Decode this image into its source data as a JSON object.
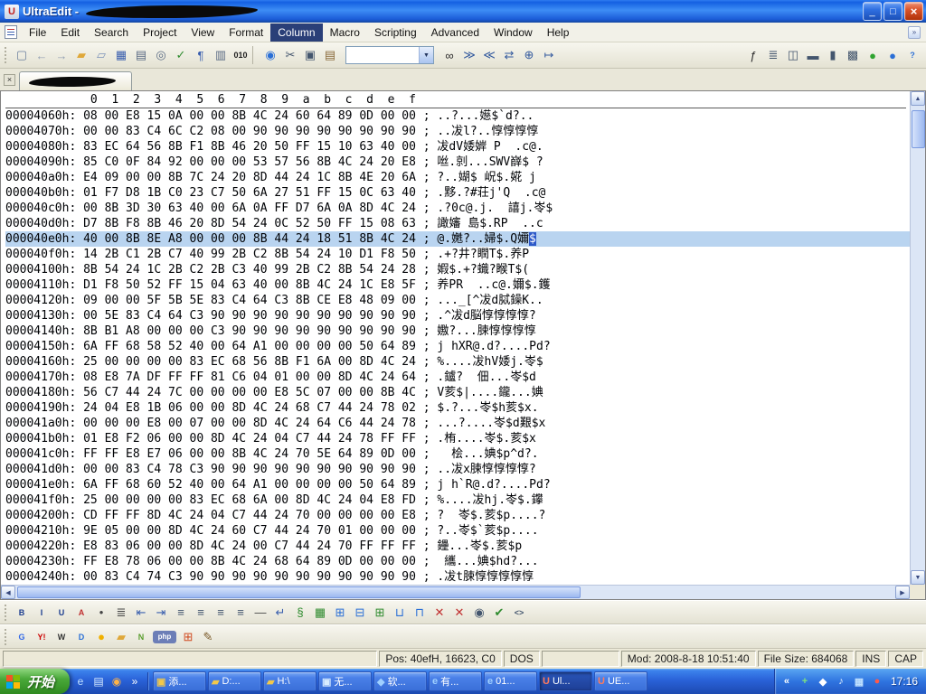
{
  "window": {
    "title": "UltraEdit -",
    "minimize_glyph": "_",
    "maximize_glyph": "□",
    "close_glyph": "×"
  },
  "menu": {
    "items": [
      {
        "name": "menu-item-file",
        "label": "File"
      },
      {
        "name": "menu-item-edit",
        "label": "Edit"
      },
      {
        "name": "menu-item-search",
        "label": "Search"
      },
      {
        "name": "menu-item-project",
        "label": "Project"
      },
      {
        "name": "menu-item-view",
        "label": "View"
      },
      {
        "name": "menu-item-format",
        "label": "Format"
      },
      {
        "name": "menu-item-column",
        "label": "Column",
        "cls": "active"
      },
      {
        "name": "menu-item-macro",
        "label": "Macro"
      },
      {
        "name": "menu-item-scripting",
        "label": "Scripting"
      },
      {
        "name": "menu-item-advanced",
        "label": "Advanced"
      },
      {
        "name": "menu-item-window",
        "label": "Window"
      },
      {
        "name": "menu-item-help",
        "label": "Help"
      }
    ]
  },
  "toolbar": {
    "search_value": "",
    "combo_arrow": "▼",
    "group_a": [
      {
        "name": "new-file-icon",
        "g": "▢",
        "c": "#6b7f9e"
      },
      {
        "name": "back-icon",
        "g": "←",
        "c": "#93a0b4"
      },
      {
        "name": "forward-icon",
        "g": "→",
        "c": "#93a0b4"
      },
      {
        "name": "open-file-icon",
        "g": "▰",
        "c": "#dfa83a"
      },
      {
        "name": "ftp-open-icon",
        "g": "▱",
        "c": "#7a92b8"
      },
      {
        "name": "save-icon",
        "g": "▦",
        "c": "#3a5fae"
      },
      {
        "name": "print-icon",
        "g": "▤",
        "c": "#5a6b84"
      },
      {
        "name": "print-preview-icon",
        "g": "◎",
        "c": "#5a6b84"
      },
      {
        "name": "spell-check-icon",
        "g": "✓",
        "c": "#2e8b2e"
      },
      {
        "name": "word-wrap-icon",
        "g": "¶",
        "c": "#3a5fae"
      },
      {
        "name": "column-mode-icon",
        "g": "▥",
        "c": "#5a6b84"
      },
      {
        "name": "hex-edit-icon",
        "g": "010",
        "c": "#1c1c1c",
        "cls": "txt"
      },
      {
        "name": "separator",
        "g": "",
        "cls": "sep"
      }
    ],
    "group_b": [
      {
        "name": "browser-view-icon",
        "g": "◉",
        "c": "#2a6fd6"
      },
      {
        "name": "cut-icon",
        "g": "✂",
        "c": "#44566e"
      },
      {
        "name": "copy-icon",
        "g": "▣",
        "c": "#44566e"
      },
      {
        "name": "paste-icon",
        "g": "▤",
        "c": "#8a6b3c"
      }
    ],
    "group_c": [
      {
        "name": "find-icon",
        "g": "∞",
        "c": "#2c2c2c"
      },
      {
        "name": "find-next-icon",
        "g": "≫",
        "c": "#335a9e"
      },
      {
        "name": "find-prev-icon",
        "g": "≪",
        "c": "#335a9e"
      },
      {
        "name": "replace-icon",
        "g": "⇄",
        "c": "#335a9e"
      },
      {
        "name": "find-in-files-icon",
        "g": "⊕",
        "c": "#335a9e"
      },
      {
        "name": "goto-icon",
        "g": "↦",
        "c": "#335a9e"
      }
    ],
    "group_d": [
      {
        "name": "function-list-icon",
        "g": "ƒ",
        "c": "#2c2c2c"
      },
      {
        "name": "tag-list-icon",
        "g": "≣",
        "c": "#44566e"
      },
      {
        "name": "split-window-icon",
        "g": "◫",
        "c": "#44566e"
      },
      {
        "name": "tile-horizontal-icon",
        "g": "▬",
        "c": "#44566e"
      },
      {
        "name": "tile-vertical-icon",
        "g": "▮",
        "c": "#44566e"
      },
      {
        "name": "cascade-icon",
        "g": "▩",
        "c": "#44566e"
      },
      {
        "name": "macro-play-icon",
        "g": "●",
        "c": "#2fa32f"
      },
      {
        "name": "macro-record-icon",
        "g": "●",
        "c": "#2a6fd6"
      },
      {
        "name": "help-icon",
        "g": "?",
        "c": "#2a6fd6",
        "cls": "txt"
      }
    ]
  },
  "tabbar": {
    "close_glyph": "×"
  },
  "hex": {
    "header": "            0  1  2  3  4  5  6  7  8  9  a  b  c  d  e  f",
    "rows": [
      {
        "text": "00004060h: 08 00 E8 15 0A 00 00 8B 4C 24 60 64 89 0D 00 00 ; ..?...嬨$`d?.."
      },
      {
        "text": "00004070h: 00 00 83 C4 6C C2 08 00 90 90 90 90 90 90 90 90 ; ..冹l?..惇惇惇惇"
      },
      {
        "text": "00004080h: 83 EC 64 56 8B F1 8B 46 20 50 FF 15 10 63 40 00 ; 冹dV婑婩 P  .c@."
      },
      {
        "text": "00004090h: 85 C0 0F 84 92 00 00 00 53 57 56 8B 4C 24 20 E8 ; 咝.剠...SWV嶭$ ?"
      },
      {
        "text": "000040a0h: E4 09 00 00 8B 7C 24 20 8D 44 24 1C 8B 4E 20 6A ; ?..媩$ 岲$.婲 j"
      },
      {
        "text": "000040b0h: 01 F7 D8 1B C0 23 C7 50 6A 27 51 FF 15 0C 63 40 ; .黟.?#荘j'Q  .c@"
      },
      {
        "text": "000040c0h: 00 8B 3D 30 63 40 00 6A 0A FF D7 6A 0A 8D 4C 24 ; .?0c@.j.  譆j.岺$"
      },
      {
        "text": "000040d0h: D7 8B F8 8B 46 20 8D 54 24 0C 52 50 FF 15 08 63 ; 譀嬸 島$.RP  ..c"
      },
      {
        "text": "000040e0h: 40 00 8B 8E A8 00 00 00 8B 44 24 18 51 8B 4C 24 ; @.嬎?..婦$.Q嬭",
        "cursor": "$",
        "cls": "selected",
        "name": "selected-hex-row"
      },
      {
        "text": "000040f0h: 14 2B C1 2B C7 40 99 2B C2 8B 54 24 10 D1 F8 50 ; .+?井?瞤T$.养P"
      },
      {
        "text": "00004100h: 8B 54 24 1C 2B C2 2B C3 40 99 2B C2 8B 54 24 28 ; 婽$.+?蟙?睺T$("
      },
      {
        "text": "00004110h: D1 F8 50 52 FF 15 04 63 40 00 8B 4C 24 1C E8 5F ; 养PR  ..c@.嬭$.鑊"
      },
      {
        "text": "00004120h: 09 00 00 5F 5B 5E 83 C4 64 C3 8B CE E8 48 09 00 ; ..._[^冹d脦鐰K.."
      },
      {
        "text": "00004130h: 00 5E 83 C4 64 C3 90 90 90 90 90 90 90 90 90 90 ; .^冹d脳惇惇惇惇?"
      },
      {
        "text": "00004140h: 8B B1 A8 00 00 00 C3 90 90 90 90 90 90 90 90 90 ; 嫐?...脨惇惇惇惇"
      },
      {
        "text": "00004150h: 6A FF 68 58 52 40 00 64 A1 00 00 00 00 50 64 89 ; j hXR@.d?....Pd?"
      },
      {
        "text": "00004160h: 25 00 00 00 00 83 EC 68 56 8B F1 6A 00 8D 4C 24 ; %....冹hV婑j.岺$"
      },
      {
        "text": "00004170h: 08 E8 7A DF FF FF 81 C6 04 01 00 00 8D 4C 24 64 ; .鑪?  佃...岺$d"
      },
      {
        "text": "00004180h: 56 C7 44 24 7C 00 00 00 00 E8 5C 07 00 00 8B 4C ; V荄$|....鑨...婰"
      },
      {
        "text": "00004190h: 24 04 E8 1B 06 00 00 8D 4C 24 68 C7 44 24 78 02 ; $.?...岺$h荄$x."
      },
      {
        "text": "000041a0h: 00 00 00 E8 00 07 00 00 8D 4C 24 64 C6 44 24 78 ; ...?....岺$d艱$x"
      },
      {
        "text": "000041b0h: 01 E8 F2 06 00 00 8D 4C 24 04 C7 44 24 78 FF FF ; .栯....岺$.荄$x"
      },
      {
        "text": "000041c0h: FF FF E8 E7 06 00 00 8B 4C 24 70 5E 64 89 0D 00 ;   桧...婰$p^d?."
      },
      {
        "text": "000041d0h: 00 00 83 C4 78 C3 90 90 90 90 90 90 90 90 90 90 ; ..冹x脨惇惇惇惇?"
      },
      {
        "text": "000041e0h: 6A FF 68 60 52 40 00 64 A1 00 00 00 00 50 64 89 ; j h`R@.d?....Pd?"
      },
      {
        "text": "000041f0h: 25 00 00 00 00 83 EC 68 6A 00 8D 4C 24 04 E8 FD ; %....冹hj.岺$.鑻"
      },
      {
        "text": "00004200h: CD FF FF 8D 4C 24 04 C7 44 24 70 00 00 00 00 E8 ; ?  岺$.荄$p....?"
      },
      {
        "text": "00004210h: 9E 05 00 00 8D 4C 24 60 C7 44 24 70 01 00 00 00 ; ?..岺$`荄$p...."
      },
      {
        "text": "00004220h: E8 83 06 00 00 8D 4C 24 00 C7 44 24 70 FF FF FF ; 鑸...岺$.荄$p"
      },
      {
        "text": "00004230h: FF E8 78 06 00 00 8B 4C 24 68 64 89 0D 00 00 00 ;  纗...婰$hd?..."
      },
      {
        "text": "00004240h: 00 83 C4 74 C3 90 90 90 90 90 90 90 90 90 90 90 ; .冹t脨惇惇惇惇惇"
      }
    ]
  },
  "scrollbar": {
    "up": "▲",
    "down": "▼",
    "left": "◀",
    "right": "▶"
  },
  "html_toolbar": {
    "items": [
      {
        "name": "bold-icon",
        "g": "B",
        "c": "#1a3c8f",
        "cls": "txt"
      },
      {
        "name": "italic-icon",
        "g": "I",
        "c": "#1a3c8f",
        "cls": "txt"
      },
      {
        "name": "underline-icon",
        "g": "U",
        "c": "#1a3c8f",
        "cls": "txt"
      },
      {
        "name": "font-color-icon",
        "g": "A",
        "c": "#c03030",
        "cls": "txt"
      },
      {
        "name": "bullet-list-icon",
        "g": "•",
        "c": "#444444"
      },
      {
        "name": "numbered-list-icon",
        "g": "≣",
        "c": "#444444"
      },
      {
        "name": "outdent-icon",
        "g": "⇤",
        "c": "#3a5fae"
      },
      {
        "name": "indent-icon",
        "g": "⇥",
        "c": "#3a5fae"
      },
      {
        "name": "align-left-icon",
        "g": "≡",
        "c": "#44566e"
      },
      {
        "name": "align-center-icon",
        "g": "≡",
        "c": "#44566e"
      },
      {
        "name": "align-right-icon",
        "g": "≡",
        "c": "#44566e"
      },
      {
        "name": "justify-icon",
        "g": "≡",
        "c": "#44566e"
      },
      {
        "name": "horizontal-rule-icon",
        "g": "—",
        "c": "#444444"
      },
      {
        "name": "line-break-icon",
        "g": "↵",
        "c": "#3a5fae"
      },
      {
        "name": "anchor-icon",
        "g": "§",
        "c": "#2e8b2e"
      },
      {
        "name": "image-icon",
        "g": "▦",
        "c": "#2e8b2e"
      },
      {
        "name": "table-icon",
        "g": "⊞",
        "c": "#2a6fd6"
      },
      {
        "name": "insert-row-icon",
        "g": "⊟",
        "c": "#2a6fd6"
      },
      {
        "name": "insert-column-icon",
        "g": "⊞",
        "c": "#2e8b2e"
      },
      {
        "name": "merge-cells-icon",
        "g": "⊔",
        "c": "#2a6fd6"
      },
      {
        "name": "split-cell-icon",
        "g": "⊓",
        "c": "#2a6fd6"
      },
      {
        "name": "delete-row-icon",
        "g": "✕",
        "c": "#c03030"
      },
      {
        "name": "delete-column-icon",
        "g": "✕",
        "c": "#c03030"
      },
      {
        "name": "preview-icon",
        "g": "◉",
        "c": "#44566e"
      },
      {
        "name": "clean-html-icon",
        "g": "✔",
        "c": "#2e8b2e"
      },
      {
        "name": "view-source-icon",
        "g": "<>",
        "c": "#44566e",
        "cls": "txt"
      }
    ]
  },
  "user_toolbar": {
    "items": [
      {
        "name": "google-icon",
        "g": "G",
        "c": "#3369e8",
        "cls": "txt"
      },
      {
        "name": "yahoo-icon",
        "g": "Y!",
        "c": "#cc0000",
        "cls": "txt"
      },
      {
        "name": "wikipedia-icon",
        "g": "W",
        "c": "#333333",
        "cls": "txt"
      },
      {
        "name": "dictionary-icon",
        "g": "D",
        "c": "#2a6fd6",
        "cls": "txt"
      },
      {
        "name": "lightbulb-icon",
        "g": "●",
        "c": "#f0b000"
      },
      {
        "name": "folder-icon",
        "g": "▰",
        "c": "#dfa83a"
      },
      {
        "name": "notepad-icon",
        "g": "N",
        "c": "#5a9e2f",
        "cls": "txt"
      },
      {
        "name": "php-icon",
        "g": "php",
        "c": "#ffffff",
        "bg": "#6c7eb7",
        "cls": "txt badge"
      },
      {
        "name": "windows-icon",
        "g": "⊞",
        "c": "#d04a20"
      },
      {
        "name": "edit-pencil-icon",
        "g": "✎",
        "c": "#7a5a2a"
      }
    ]
  },
  "statusbar": {
    "position": "Pos: 40efH, 16623, C0",
    "format": "DOS",
    "modified": "Mod: 2008-8-18 10:51:40",
    "file_size": "File Size: 684068",
    "insert_mode": "INS",
    "caps": "CAP"
  },
  "taskbar": {
    "start_label": "开始",
    "quick_launch": [
      {
        "name": "ie-quicklaunch-icon",
        "g": "e",
        "c": "#bfe0ff"
      },
      {
        "name": "show-desktop-icon",
        "g": "▤",
        "c": "#d8ecff"
      },
      {
        "name": "media-player-icon",
        "g": "◉",
        "c": "#ffb347"
      },
      {
        "name": "overflow-chevron-icon",
        "g": "»",
        "c": "#ffffff"
      }
    ],
    "tasks": [
      {
        "label": "添...",
        "g": "▣",
        "ic": "#f2c84b"
      },
      {
        "label": "D:...",
        "g": "▰",
        "ic": "#f2c84b"
      },
      {
        "label": "H:\\",
        "g": "▰",
        "ic": "#f2c84b"
      },
      {
        "label": "无...",
        "g": "▣",
        "ic": "#d8ecff"
      },
      {
        "label": "软...",
        "g": "◆",
        "ic": "#9fd0ff"
      },
      {
        "label": "有...",
        "g": "e",
        "ic": "#9fd0ff"
      },
      {
        "label": "01...",
        "g": "e",
        "ic": "#9fd0ff"
      },
      {
        "label": "Ul...",
        "g": "U",
        "ic": "#ff7a5a",
        "cls": "active",
        "name": "taskbar-button-ultraedit-active"
      },
      {
        "label": "UE...",
        "g": "U",
        "ic": "#ff7a5a"
      }
    ],
    "tray": {
      "icons": [
        {
          "name": "tray-chevron-icon",
          "g": "«",
          "c": "#ffffff"
        },
        {
          "name": "antivirus-tray-icon",
          "g": "+",
          "c": "#7fe37f"
        },
        {
          "name": "ime-tray-icon",
          "g": "◆",
          "c": "#ffffff"
        },
        {
          "name": "volume-tray-icon",
          "g": "♪",
          "c": "#e8f4ff"
        },
        {
          "name": "network-tray-icon",
          "g": "▦",
          "c": "#bfe0ff"
        },
        {
          "name": "security-tray-icon",
          "g": "●",
          "c": "#ff5a4a"
        }
      ],
      "time": "17:16"
    }
  }
}
